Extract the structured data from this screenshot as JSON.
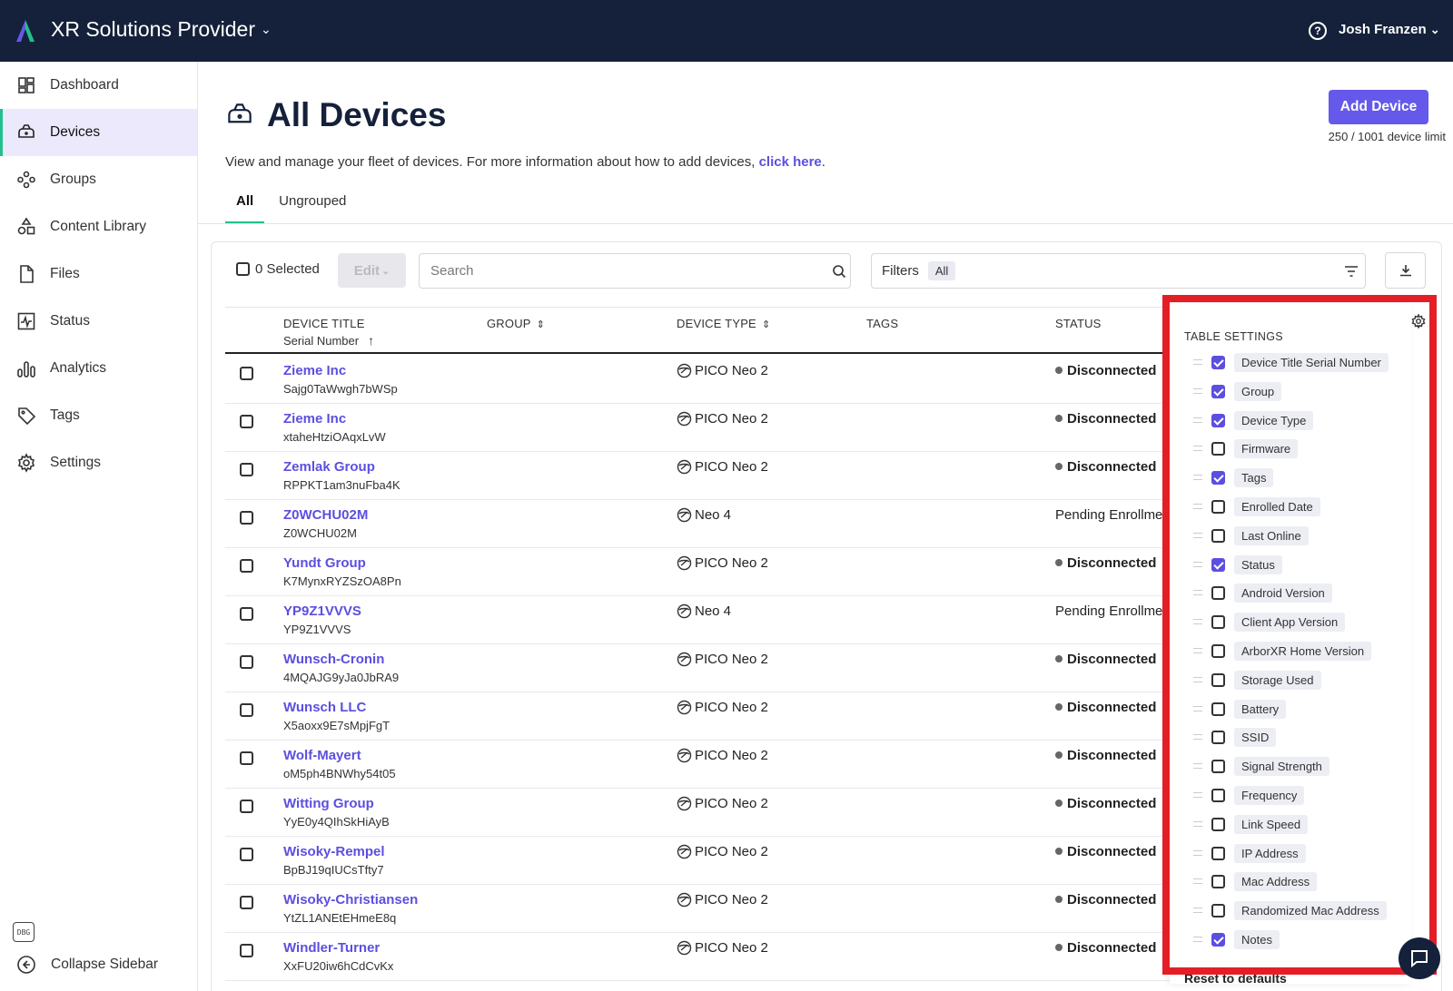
{
  "topbar": {
    "org_name": "XR Solutions Provider",
    "user_name": "Josh Franzen",
    "help_icon": "question-circle-icon",
    "brand_color": "#15213a"
  },
  "sidebar": {
    "items": [
      {
        "label": "Dashboard",
        "icon": "dashboard-icon"
      },
      {
        "label": "Devices",
        "icon": "headset-icon",
        "active": true
      },
      {
        "label": "Groups",
        "icon": "groups-icon"
      },
      {
        "label": "Content Library",
        "icon": "shapes-icon"
      },
      {
        "label": "Files",
        "icon": "file-icon"
      },
      {
        "label": "Status",
        "icon": "activity-icon"
      },
      {
        "label": "Analytics",
        "icon": "bar-chart-icon"
      },
      {
        "label": "Tags",
        "icon": "tag-icon"
      },
      {
        "label": "Settings",
        "icon": "gear-icon"
      }
    ],
    "debug_label": "DBG",
    "collapse_label": "Collapse Sidebar",
    "active_accent": "#21c08b",
    "active_bg": "#ebe9fb"
  },
  "page": {
    "title": "All Devices",
    "description": "View and manage your fleet of devices. For more information about how to add devices, ",
    "description_link": "click here",
    "description_end": ".",
    "add_button": "Add Device",
    "device_limit": "250 / 1001 device limit",
    "tabs": [
      "All",
      "Ungrouped"
    ],
    "accent": "#6459ea"
  },
  "toolbar": {
    "selected_label": "0 Selected",
    "edit_label": "Edit",
    "search_placeholder": "Search",
    "filters_label": "Filters",
    "filters_value": "All"
  },
  "table": {
    "columns": {
      "device_title": "DEVICE TITLE",
      "device_title_sub": "Serial Number",
      "group": "GROUP",
      "device_type": "DEVICE TYPE",
      "tags": "TAGS",
      "status": "STATUS"
    },
    "rows": [
      {
        "title": "Zieme Inc",
        "serial": "Sajg0TaWwgh7bWSp",
        "type": "PICO Neo 2",
        "status": "Disconnected"
      },
      {
        "title": "Zieme Inc",
        "serial": "xtaheHtziOAqxLvW",
        "type": "PICO Neo 2",
        "status": "Disconnected"
      },
      {
        "title": "Zemlak Group",
        "serial": "RPPKT1am3nuFba4K",
        "type": "PICO Neo 2",
        "status": "Disconnected"
      },
      {
        "title": "Z0WCHU02M",
        "serial": "Z0WCHU02M",
        "type": "Neo 4",
        "status": "Pending Enrollme"
      },
      {
        "title": "Yundt Group",
        "serial": "K7MynxRYZSzOA8Pn",
        "type": "PICO Neo 2",
        "status": "Disconnected"
      },
      {
        "title": "YP9Z1VVVS",
        "serial": "YP9Z1VVVS",
        "type": "Neo 4",
        "status": "Pending Enrollme"
      },
      {
        "title": "Wunsch-Cronin",
        "serial": "4MQAJG9yJa0JbRA9",
        "type": "PICO Neo 2",
        "status": "Disconnected"
      },
      {
        "title": "Wunsch LLC",
        "serial": "X5aoxx9E7sMpjFgT",
        "type": "PICO Neo 2",
        "status": "Disconnected"
      },
      {
        "title": "Wolf-Mayert",
        "serial": "oM5ph4BNWhy54t05",
        "type": "PICO Neo 2",
        "status": "Disconnected"
      },
      {
        "title": "Witting Group",
        "serial": "YyE0y4QIhSkHiAyB",
        "type": "PICO Neo 2",
        "status": "Disconnected"
      },
      {
        "title": "Wisoky-Rempel",
        "serial": "BpBJ19qIUCsTfty7",
        "type": "PICO Neo 2",
        "status": "Disconnected"
      },
      {
        "title": "Wisoky-Christiansen",
        "serial": "YtZL1ANEtEHmeE8q",
        "type": "PICO Neo 2",
        "status": "Disconnected"
      },
      {
        "title": "Windler-Turner",
        "serial": "XxFU20iw6hCdCvKx",
        "type": "PICO Neo 2",
        "status": "Disconnected"
      }
    ]
  },
  "table_settings": {
    "title": "TABLE SETTINGS",
    "options": [
      {
        "label": "Device Title Serial Number",
        "checked": true
      },
      {
        "label": "Group",
        "checked": true
      },
      {
        "label": "Device Type",
        "checked": true
      },
      {
        "label": "Firmware",
        "checked": false
      },
      {
        "label": "Tags",
        "checked": true
      },
      {
        "label": "Enrolled Date",
        "checked": false
      },
      {
        "label": "Last Online",
        "checked": false
      },
      {
        "label": "Status",
        "checked": true
      },
      {
        "label": "Android Version",
        "checked": false
      },
      {
        "label": "Client App Version",
        "checked": false
      },
      {
        "label": "ArborXR Home Version",
        "checked": false
      },
      {
        "label": "Storage Used",
        "checked": false
      },
      {
        "label": "Battery",
        "checked": false
      },
      {
        "label": "SSID",
        "checked": false
      },
      {
        "label": "Signal Strength",
        "checked": false
      },
      {
        "label": "Frequency",
        "checked": false
      },
      {
        "label": "Link Speed",
        "checked": false
      },
      {
        "label": "IP Address",
        "checked": false
      },
      {
        "label": "Mac Address",
        "checked": false
      },
      {
        "label": "Randomized Mac Address",
        "checked": false
      },
      {
        "label": "Notes",
        "checked": true
      }
    ],
    "reset_label": "Reset to defaults",
    "highlight_color": "#e41e26"
  }
}
